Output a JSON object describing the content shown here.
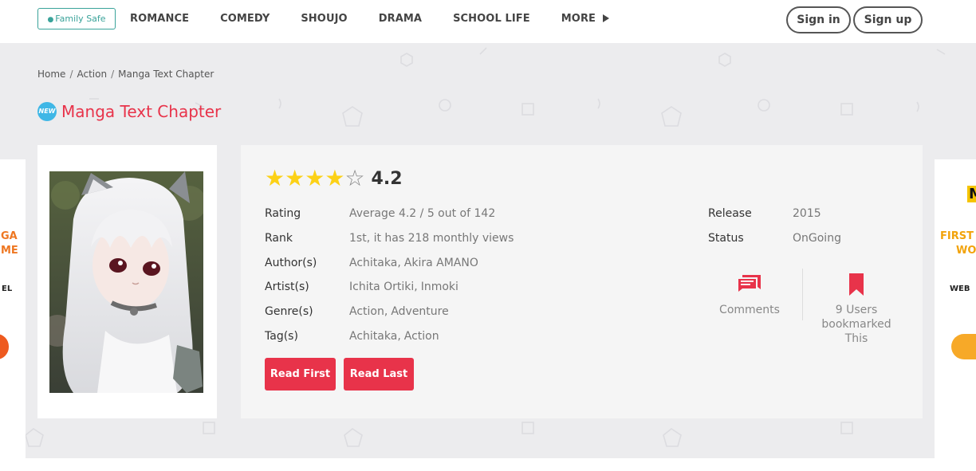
{
  "header": {
    "family_safe": "Family Safe",
    "nav": [
      "ROMANCE",
      "COMEDY",
      "SHOUJO",
      "DRAMA",
      "SCHOOL LIFE"
    ],
    "more": "MORE",
    "sign_in": "Sign in",
    "sign_up": "Sign up"
  },
  "breadcrumb": [
    "Home",
    "Action",
    "Manga Text Chapter"
  ],
  "title": {
    "badge": "NEW",
    "text": "Manga Text Chapter"
  },
  "rating": {
    "score": "4.2",
    "stars_filled": 4,
    "stars_total": 5
  },
  "details": {
    "rating": {
      "label": "Rating",
      "value": "Average 4.2 / 5 out of 142"
    },
    "rank": {
      "label": "Rank",
      "value": "1st, it has 218 monthly views"
    },
    "authors": {
      "label": "Author(s)",
      "values": [
        "Achitaka",
        "Akira AMANO"
      ]
    },
    "artists": {
      "label": "Artist(s)",
      "values": [
        "Ichita Ortiki",
        "Inmoki"
      ]
    },
    "genres": {
      "label": "Genre(s)",
      "values": [
        "Action",
        "Adventure"
      ]
    },
    "tags": {
      "label": "Tag(s)",
      "values": [
        "Achitaka",
        "Action"
      ]
    }
  },
  "release": {
    "label": "Release",
    "value": "2015"
  },
  "status": {
    "label": "Status",
    "value": "OnGoing"
  },
  "actions": {
    "read_first": "Read First",
    "read_last": "Read Last"
  },
  "stats": {
    "comments": "Comments",
    "bookmarked": "9 Users bookmarked This"
  },
  "ads": {
    "left_line1": "GA",
    "left_line2": "ME",
    "left_line3": "EL",
    "right_logo": "M",
    "right_line1": "FIRST",
    "right_line2": "WOR",
    "right_line3": "WEB"
  },
  "colors": {
    "accent": "#e8334a",
    "family_safe": "#3aa39a",
    "star": "#fcd116",
    "badge": "#3fb7e6",
    "band": "#ececee"
  }
}
